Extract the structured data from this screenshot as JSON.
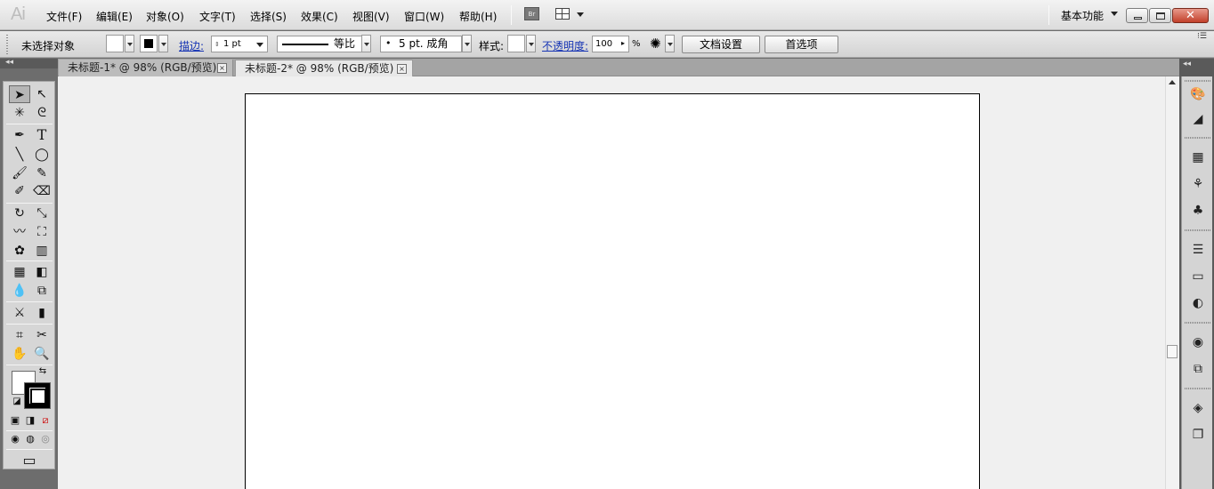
{
  "app": {
    "logo": "Ai"
  },
  "menu": {
    "items": [
      "文件(F)",
      "编辑(E)",
      "对象(O)",
      "文字(T)",
      "选择(S)",
      "效果(C)",
      "视图(V)",
      "窗口(W)",
      "帮助(H)"
    ],
    "bridge_label": "Br"
  },
  "workspace": {
    "label": "基本功能"
  },
  "window_controls": {
    "close_glyph": "✕"
  },
  "control_bar": {
    "selection_status": "未选择对象",
    "stroke_label": "描边:",
    "stroke_weight": "1 pt",
    "profile_label": "等比",
    "brush_label": "5 pt. 成角",
    "style_label": "样式:",
    "opacity_label": "不透明度:",
    "opacity_value": "100",
    "opacity_unit": "%",
    "doc_setup_button": "文档设置",
    "prefs_button": "首选项"
  },
  "tabs": [
    {
      "label": "未标题-1* @ 98% (RGB/预览)",
      "active": false
    },
    {
      "label": "未标题-2* @ 98% (RGB/预览)",
      "active": true
    }
  ],
  "tab_close_glyph": "×",
  "tools": {
    "selection": "➤",
    "direct_selection": "↖",
    "magic_wand": "✳",
    "lasso": "ᘓ",
    "pen": "✒",
    "type": "T",
    "line": "╲",
    "ellipse": "◯",
    "paintbrush": "🖌",
    "pencil": "✎",
    "blob_brush": "✐",
    "eraser": "⌫",
    "rotate": "↻",
    "scale": "⤡",
    "warp": "〰",
    "free_transform": "⛶",
    "symbol_sprayer": "✿",
    "column_graph": "▥",
    "mesh": "▦",
    "gradient": "◧",
    "eyedropper": "💧",
    "blend": "⧉",
    "slice": "⚔",
    "graph": "▮",
    "artboard": "⌗",
    "knife": "✂",
    "hand": "✋",
    "zoom": "🔍",
    "swap": "⇆",
    "default_colors": "◪",
    "color_mode": "▣",
    "gradient_mode": "◨",
    "none_mode": "⧄",
    "draw_normal": "◉",
    "draw_behind": "◍",
    "draw_inside": "◎",
    "screen_mode": "▭"
  },
  "dock_icons": [
    "color-guide-icon",
    "gradient-ramp-icon",
    "swatches-icon",
    "brushes-icon",
    "symbols-icon",
    "stroke-icon",
    "gradient-icon",
    "transparency-icon",
    "appearance-icon",
    "graphic-styles-icon",
    "layers-icon",
    "artboards-icon"
  ]
}
